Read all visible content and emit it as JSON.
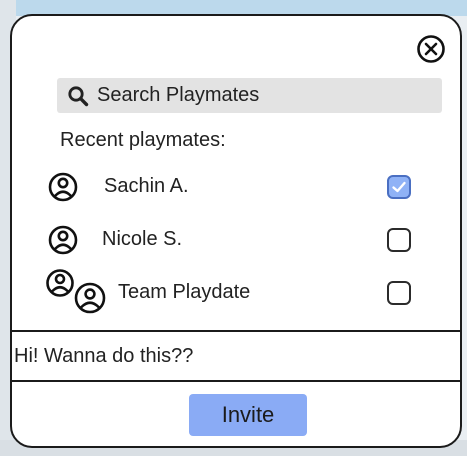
{
  "dialog": {
    "close_icon": "close-circle-icon",
    "search": {
      "placeholder": "Search Playmates",
      "value": "",
      "icon": "search-icon"
    },
    "recent_label": "Recent playmates:",
    "playmates": [
      {
        "name": "Sachin A.",
        "avatar": "user-icon",
        "checked": true
      },
      {
        "name": "Nicole S.",
        "avatar": "user-icon",
        "checked": false
      },
      {
        "name": "Team Playdate",
        "avatar": "group-icon",
        "checked": false
      }
    ],
    "message": "Hi! Wanna do this??",
    "invite_label": "Invite"
  },
  "colors": {
    "accent": "#8aabf5",
    "checkbox_checked": "#8fb2f6",
    "search_bg": "#e3e3e3",
    "border": "#1b1b1b"
  }
}
